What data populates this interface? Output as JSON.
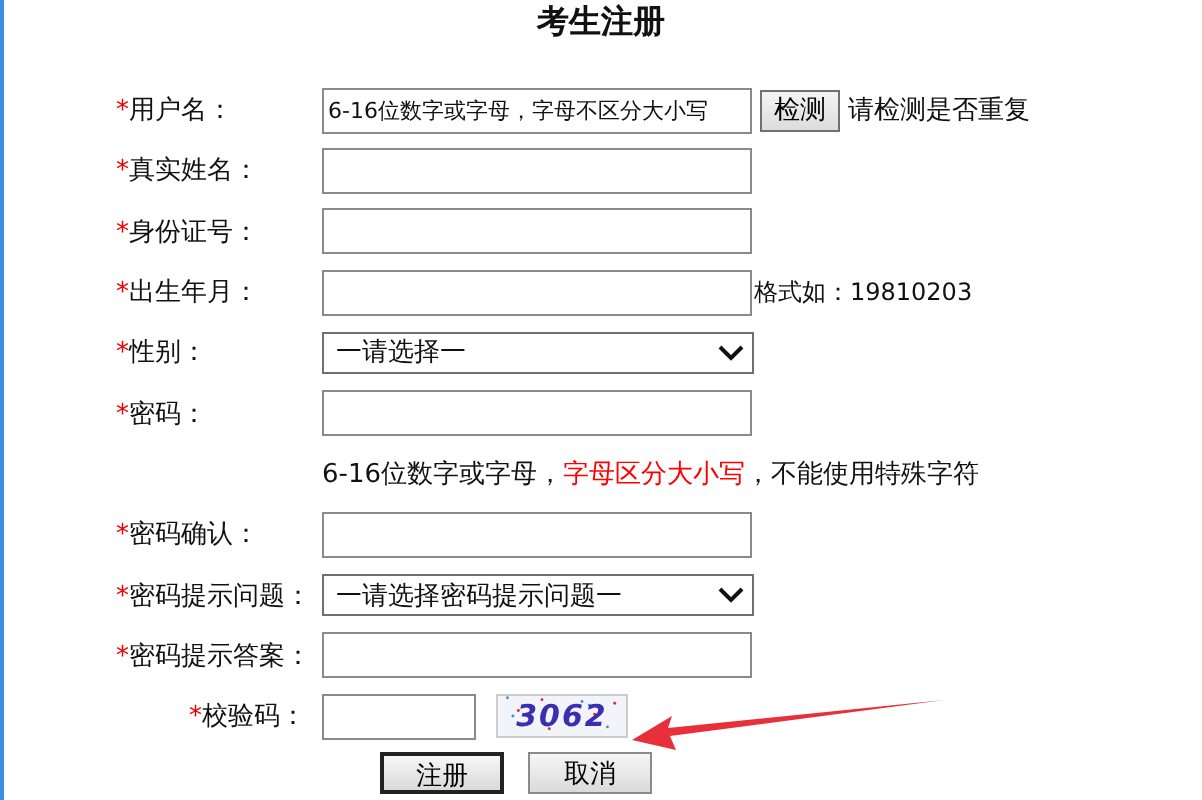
{
  "title": "考生注册",
  "rows": [
    {
      "kind": "text",
      "marker": "*",
      "label": "用户名：",
      "value": "6-16位数字或字母，字母不区分大小写",
      "button": "检测",
      "note": "请检测是否重复"
    },
    {
      "kind": "text",
      "marker": "*",
      "label": "真实姓名："
    },
    {
      "kind": "text",
      "marker": "*",
      "label": "身份证号："
    },
    {
      "kind": "text",
      "marker": "*",
      "label": "出生年月：",
      "note": "格式如：19810203"
    },
    {
      "kind": "select",
      "marker": "*",
      "label": "性别：",
      "value": "一请选择一"
    },
    {
      "kind": "text",
      "marker": "*",
      "label": "密码："
    },
    {
      "kind": "hint",
      "parts": [
        {
          "text": "6-16位数字或字母，",
          "warning": false
        },
        {
          "text": "字母区分大小写",
          "warning": true
        },
        {
          "text": "，不能使用特殊字符",
          "warning": false
        }
      ]
    },
    {
      "kind": "text",
      "marker": "*",
      "label": "密码确认："
    },
    {
      "kind": "select",
      "marker": "*",
      "label": "密码提示问题：",
      "value": "一请选择密码提示问题一"
    },
    {
      "kind": "text",
      "marker": "*",
      "label": "密码提示答案："
    },
    {
      "kind": "captcha",
      "marker": "*",
      "label": "校验码：",
      "code": "3062"
    }
  ],
  "buttons": [
    {
      "label": "注册",
      "default": true
    },
    {
      "label": "取消",
      "default": false
    }
  ]
}
